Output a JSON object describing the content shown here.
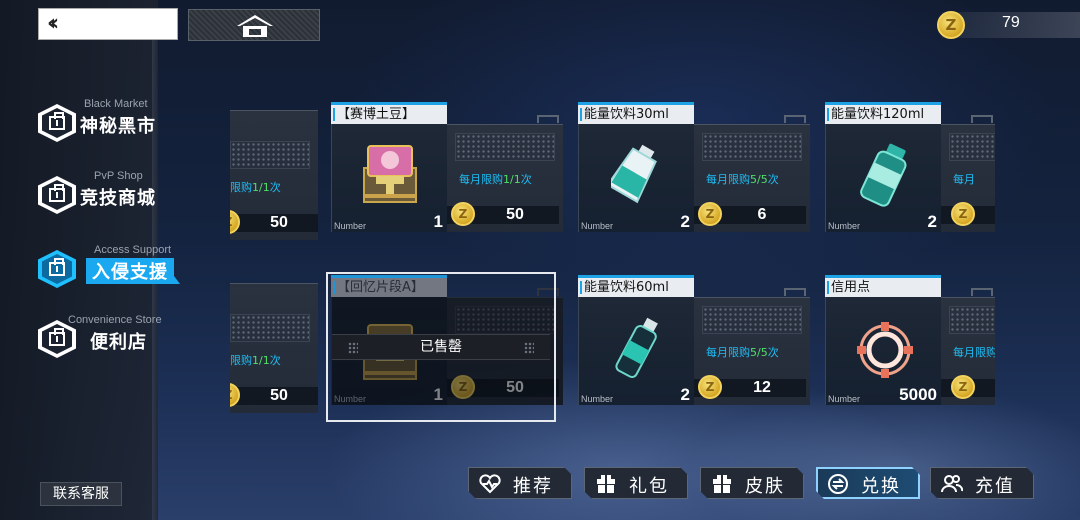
{
  "wallet": {
    "balance": "79"
  },
  "nav": {
    "items": [
      {
        "en": "Black Market",
        "cn": "神秘黑市"
      },
      {
        "en": "PvP Shop",
        "cn": "竞技商城"
      },
      {
        "en": "Access Support",
        "cn": "入侵支援"
      },
      {
        "en": "Convenience Store",
        "cn": "便利店"
      }
    ],
    "active_index": 2,
    "support_label": "联系客服"
  },
  "shop": {
    "rows": [
      {
        "left_partial": {
          "limit_prefix": "限购",
          "limit_count": "1/1",
          "limit_suffix": "次",
          "price": "50"
        },
        "items": [
          {
            "title": "【赛博土豆】",
            "number_label": "Number",
            "qty": "1",
            "limit_prefix": "每月限购",
            "limit_count": "1/1",
            "limit_suffix": "次",
            "price": "50"
          },
          {
            "title": "能量饮料30ml",
            "number_label": "Number",
            "qty": "2",
            "limit_prefix": "每月限购",
            "limit_count": "5/5",
            "limit_suffix": "次",
            "price": "6"
          },
          {
            "title": "能量饮料120ml",
            "number_label": "Number",
            "qty": "2",
            "limit_prefix": "每月"
          }
        ]
      },
      {
        "left_partial": {
          "limit_prefix": "限购",
          "limit_count": "1/1",
          "limit_suffix": "次",
          "price": "50"
        },
        "items": [
          {
            "title": "【回忆片段A】",
            "number_label": "Number",
            "qty": "1",
            "price": "50",
            "sold_label": "已售罄"
          },
          {
            "title": "能量饮料60ml",
            "number_label": "Number",
            "qty": "2",
            "limit_prefix": "每月限购",
            "limit_count": "5/5",
            "limit_suffix": "次",
            "price": "12"
          },
          {
            "title": "信用点",
            "number_label": "Number",
            "qty": "5000",
            "limit_prefix": "每月限购"
          }
        ]
      }
    ]
  },
  "tabs": [
    {
      "label": "推荐",
      "icon": "heart-chart-icon"
    },
    {
      "label": "礼包",
      "icon": "gift-icon"
    },
    {
      "label": "皮肤",
      "icon": "gift-icon"
    },
    {
      "label": "兑换",
      "icon": "exchange-icon",
      "active": true
    },
    {
      "label": "充值",
      "icon": "users-icon"
    }
  ],
  "colors": {
    "accent": "#1ea2e6",
    "limit_text": "#1fbdf5",
    "limit_count": "#4fe06a",
    "coin": "#d6a824"
  }
}
